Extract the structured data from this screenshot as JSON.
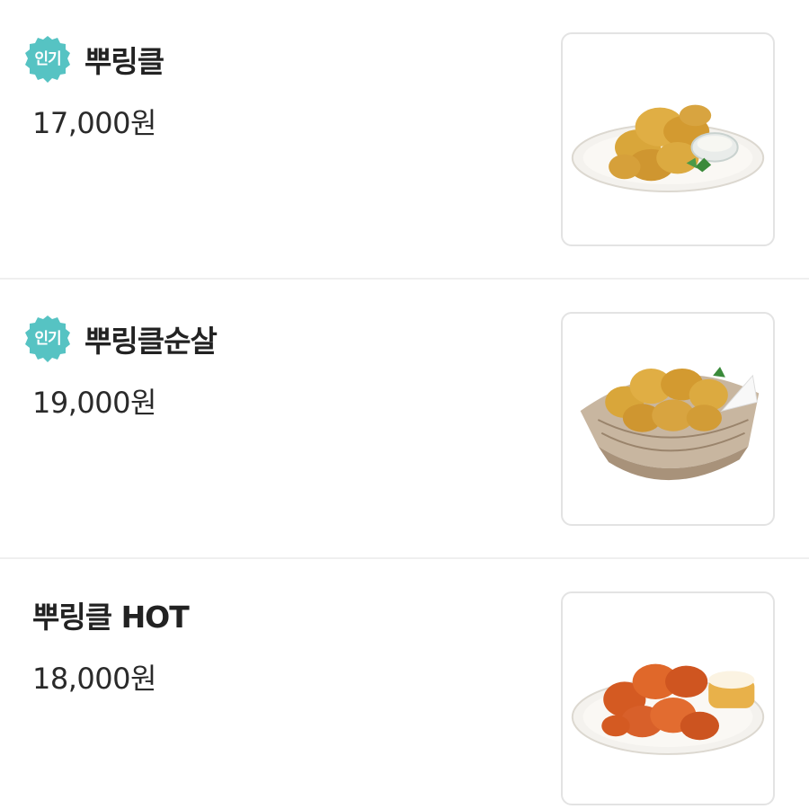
{
  "menu": {
    "items": [
      {
        "badge": "인기",
        "name": "뿌링클",
        "price": "17,000원",
        "image_icon": "chicken-plate-image"
      },
      {
        "badge": "인기",
        "name": "뿌링클순살",
        "price": "19,000원",
        "image_icon": "chicken-basket-image"
      },
      {
        "name": "뿌링클 HOT",
        "price": "18,000원",
        "image_icon": "spicy-chicken-plate-image"
      }
    ]
  },
  "colors": {
    "badge": "#56c3c3",
    "text": "#222222",
    "divider": "#efefef",
    "thumb_border": "#e3e3e3"
  }
}
